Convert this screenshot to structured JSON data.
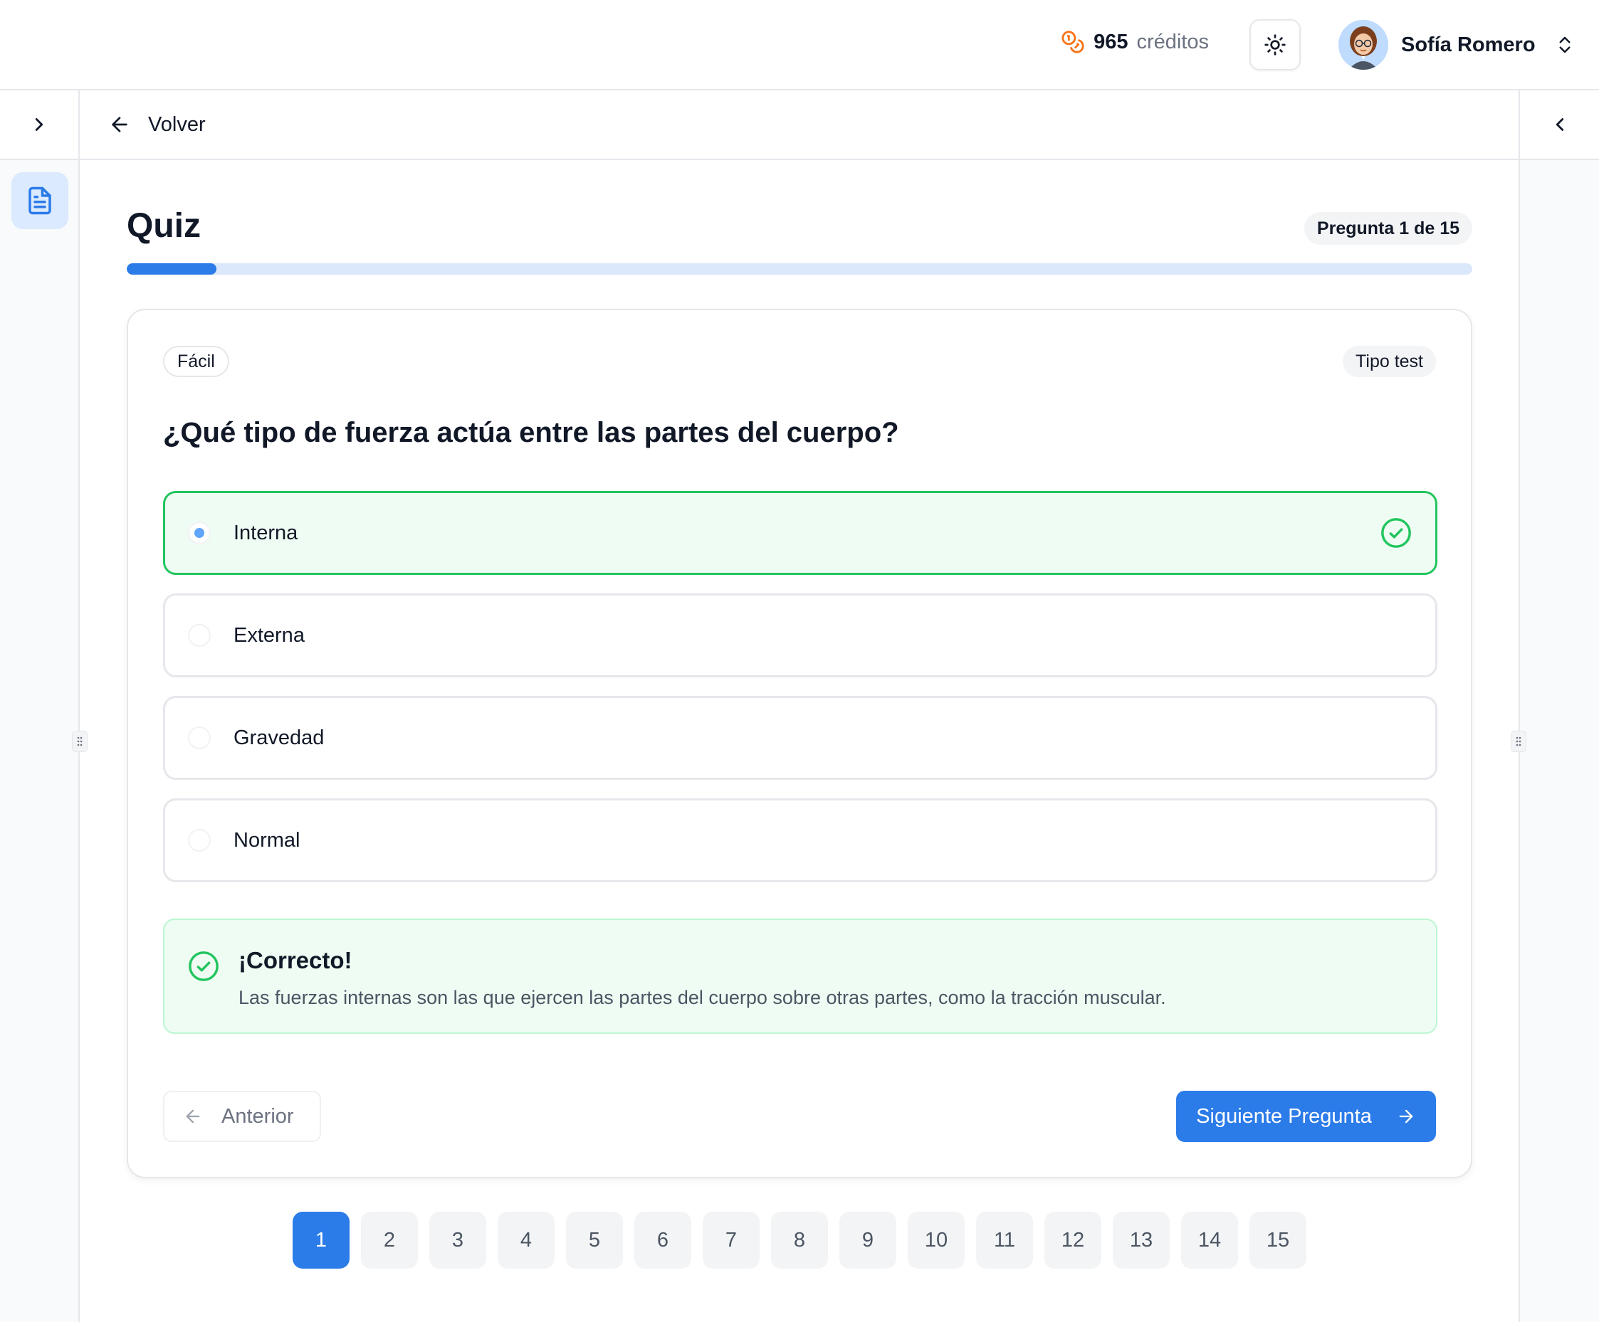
{
  "header": {
    "credits_value": "965",
    "credits_unit": "créditos",
    "user_name": "Sofía Romero"
  },
  "nav": {
    "back_label": "Volver"
  },
  "quiz": {
    "title": "Quiz",
    "counter": "Pregunta 1 de 15",
    "progress_fraction": 0.0667,
    "difficulty": "Fácil",
    "type": "Tipo test",
    "question": "¿Qué tipo de fuerza actúa entre las partes del cuerpo?",
    "options": [
      {
        "label": "Interna",
        "selected": true,
        "correct": true
      },
      {
        "label": "Externa",
        "selected": false,
        "correct": false
      },
      {
        "label": "Gravedad",
        "selected": false,
        "correct": false
      },
      {
        "label": "Normal",
        "selected": false,
        "correct": false
      }
    ],
    "feedback": {
      "title": "¡Correcto!",
      "text": "Las fuerzas internas son las que ejercen las partes del cuerpo sobre otras partes, como la tracción muscular."
    },
    "prev_label": "Anterior",
    "next_label": "Siguiente Pregunta"
  },
  "pagination": {
    "pages": [
      "1",
      "2",
      "3",
      "4",
      "5",
      "6",
      "7",
      "8",
      "9",
      "10",
      "11",
      "12",
      "13",
      "14",
      "15"
    ],
    "active": "1"
  },
  "colors": {
    "accent": "#2b7be9",
    "success": "#22c55e",
    "success_bg": "#effcf3",
    "credits_icon": "#f97316"
  },
  "icons": {
    "credits": "coins-icon",
    "theme": "sun-icon",
    "user_menu": "chevrons-up-down-icon",
    "expand_left": "chevron-right-icon",
    "collapse_right": "chevron-left-icon",
    "back": "arrow-left-icon",
    "document": "document-icon",
    "correct": "check-circle-icon",
    "prev": "arrow-left-icon",
    "next": "arrow-right-icon"
  }
}
